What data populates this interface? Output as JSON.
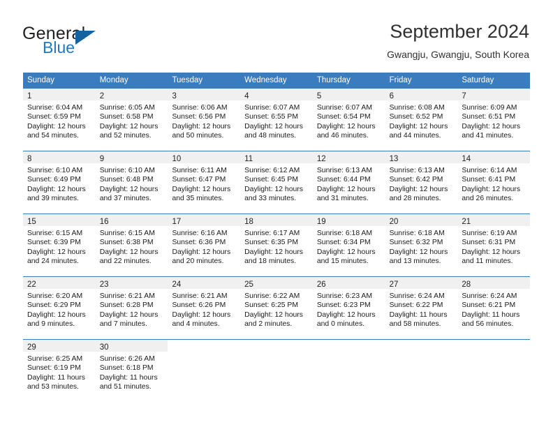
{
  "brand": {
    "general": "General",
    "blue": "Blue",
    "flag_icon": "triangle-flag-icon"
  },
  "header": {
    "title": "September 2024",
    "subtitle": "Gwangju, Gwangju, South Korea"
  },
  "calendar": {
    "weekday_headers": [
      "Sunday",
      "Monday",
      "Tuesday",
      "Wednesday",
      "Thursday",
      "Friday",
      "Saturday"
    ],
    "colors": {
      "header_blue": "#3a7cbe",
      "day_band_gray": "#f0f0f0",
      "brand_blue": "#1f78c1",
      "text": "#1a1a1a"
    },
    "weeks": [
      [
        {
          "day": "1",
          "sunrise": "Sunrise: 6:04 AM",
          "sunset": "Sunset: 6:59 PM",
          "daylight_1": "Daylight: 12 hours",
          "daylight_2": "and 54 minutes."
        },
        {
          "day": "2",
          "sunrise": "Sunrise: 6:05 AM",
          "sunset": "Sunset: 6:58 PM",
          "daylight_1": "Daylight: 12 hours",
          "daylight_2": "and 52 minutes."
        },
        {
          "day": "3",
          "sunrise": "Sunrise: 6:06 AM",
          "sunset": "Sunset: 6:56 PM",
          "daylight_1": "Daylight: 12 hours",
          "daylight_2": "and 50 minutes."
        },
        {
          "day": "4",
          "sunrise": "Sunrise: 6:07 AM",
          "sunset": "Sunset: 6:55 PM",
          "daylight_1": "Daylight: 12 hours",
          "daylight_2": "and 48 minutes."
        },
        {
          "day": "5",
          "sunrise": "Sunrise: 6:07 AM",
          "sunset": "Sunset: 6:54 PM",
          "daylight_1": "Daylight: 12 hours",
          "daylight_2": "and 46 minutes."
        },
        {
          "day": "6",
          "sunrise": "Sunrise: 6:08 AM",
          "sunset": "Sunset: 6:52 PM",
          "daylight_1": "Daylight: 12 hours",
          "daylight_2": "and 44 minutes."
        },
        {
          "day": "7",
          "sunrise": "Sunrise: 6:09 AM",
          "sunset": "Sunset: 6:51 PM",
          "daylight_1": "Daylight: 12 hours",
          "daylight_2": "and 41 minutes."
        }
      ],
      [
        {
          "day": "8",
          "sunrise": "Sunrise: 6:10 AM",
          "sunset": "Sunset: 6:49 PM",
          "daylight_1": "Daylight: 12 hours",
          "daylight_2": "and 39 minutes."
        },
        {
          "day": "9",
          "sunrise": "Sunrise: 6:10 AM",
          "sunset": "Sunset: 6:48 PM",
          "daylight_1": "Daylight: 12 hours",
          "daylight_2": "and 37 minutes."
        },
        {
          "day": "10",
          "sunrise": "Sunrise: 6:11 AM",
          "sunset": "Sunset: 6:47 PM",
          "daylight_1": "Daylight: 12 hours",
          "daylight_2": "and 35 minutes."
        },
        {
          "day": "11",
          "sunrise": "Sunrise: 6:12 AM",
          "sunset": "Sunset: 6:45 PM",
          "daylight_1": "Daylight: 12 hours",
          "daylight_2": "and 33 minutes."
        },
        {
          "day": "12",
          "sunrise": "Sunrise: 6:13 AM",
          "sunset": "Sunset: 6:44 PM",
          "daylight_1": "Daylight: 12 hours",
          "daylight_2": "and 31 minutes."
        },
        {
          "day": "13",
          "sunrise": "Sunrise: 6:13 AM",
          "sunset": "Sunset: 6:42 PM",
          "daylight_1": "Daylight: 12 hours",
          "daylight_2": "and 28 minutes."
        },
        {
          "day": "14",
          "sunrise": "Sunrise: 6:14 AM",
          "sunset": "Sunset: 6:41 PM",
          "daylight_1": "Daylight: 12 hours",
          "daylight_2": "and 26 minutes."
        }
      ],
      [
        {
          "day": "15",
          "sunrise": "Sunrise: 6:15 AM",
          "sunset": "Sunset: 6:39 PM",
          "daylight_1": "Daylight: 12 hours",
          "daylight_2": "and 24 minutes."
        },
        {
          "day": "16",
          "sunrise": "Sunrise: 6:15 AM",
          "sunset": "Sunset: 6:38 PM",
          "daylight_1": "Daylight: 12 hours",
          "daylight_2": "and 22 minutes."
        },
        {
          "day": "17",
          "sunrise": "Sunrise: 6:16 AM",
          "sunset": "Sunset: 6:36 PM",
          "daylight_1": "Daylight: 12 hours",
          "daylight_2": "and 20 minutes."
        },
        {
          "day": "18",
          "sunrise": "Sunrise: 6:17 AM",
          "sunset": "Sunset: 6:35 PM",
          "daylight_1": "Daylight: 12 hours",
          "daylight_2": "and 18 minutes."
        },
        {
          "day": "19",
          "sunrise": "Sunrise: 6:18 AM",
          "sunset": "Sunset: 6:34 PM",
          "daylight_1": "Daylight: 12 hours",
          "daylight_2": "and 15 minutes."
        },
        {
          "day": "20",
          "sunrise": "Sunrise: 6:18 AM",
          "sunset": "Sunset: 6:32 PM",
          "daylight_1": "Daylight: 12 hours",
          "daylight_2": "and 13 minutes."
        },
        {
          "day": "21",
          "sunrise": "Sunrise: 6:19 AM",
          "sunset": "Sunset: 6:31 PM",
          "daylight_1": "Daylight: 12 hours",
          "daylight_2": "and 11 minutes."
        }
      ],
      [
        {
          "day": "22",
          "sunrise": "Sunrise: 6:20 AM",
          "sunset": "Sunset: 6:29 PM",
          "daylight_1": "Daylight: 12 hours",
          "daylight_2": "and 9 minutes."
        },
        {
          "day": "23",
          "sunrise": "Sunrise: 6:21 AM",
          "sunset": "Sunset: 6:28 PM",
          "daylight_1": "Daylight: 12 hours",
          "daylight_2": "and 7 minutes."
        },
        {
          "day": "24",
          "sunrise": "Sunrise: 6:21 AM",
          "sunset": "Sunset: 6:26 PM",
          "daylight_1": "Daylight: 12 hours",
          "daylight_2": "and 4 minutes."
        },
        {
          "day": "25",
          "sunrise": "Sunrise: 6:22 AM",
          "sunset": "Sunset: 6:25 PM",
          "daylight_1": "Daylight: 12 hours",
          "daylight_2": "and 2 minutes."
        },
        {
          "day": "26",
          "sunrise": "Sunrise: 6:23 AM",
          "sunset": "Sunset: 6:23 PM",
          "daylight_1": "Daylight: 12 hours",
          "daylight_2": "and 0 minutes."
        },
        {
          "day": "27",
          "sunrise": "Sunrise: 6:24 AM",
          "sunset": "Sunset: 6:22 PM",
          "daylight_1": "Daylight: 11 hours",
          "daylight_2": "and 58 minutes."
        },
        {
          "day": "28",
          "sunrise": "Sunrise: 6:24 AM",
          "sunset": "Sunset: 6:21 PM",
          "daylight_1": "Daylight: 11 hours",
          "daylight_2": "and 56 minutes."
        }
      ],
      [
        {
          "day": "29",
          "sunrise": "Sunrise: 6:25 AM",
          "sunset": "Sunset: 6:19 PM",
          "daylight_1": "Daylight: 11 hours",
          "daylight_2": "and 53 minutes."
        },
        {
          "day": "30",
          "sunrise": "Sunrise: 6:26 AM",
          "sunset": "Sunset: 6:18 PM",
          "daylight_1": "Daylight: 11 hours",
          "daylight_2": "and 51 minutes."
        },
        {
          "day": "",
          "sunrise": "",
          "sunset": "",
          "daylight_1": "",
          "daylight_2": ""
        },
        {
          "day": "",
          "sunrise": "",
          "sunset": "",
          "daylight_1": "",
          "daylight_2": ""
        },
        {
          "day": "",
          "sunrise": "",
          "sunset": "",
          "daylight_1": "",
          "daylight_2": ""
        },
        {
          "day": "",
          "sunrise": "",
          "sunset": "",
          "daylight_1": "",
          "daylight_2": ""
        },
        {
          "day": "",
          "sunrise": "",
          "sunset": "",
          "daylight_1": "",
          "daylight_2": ""
        }
      ]
    ]
  }
}
